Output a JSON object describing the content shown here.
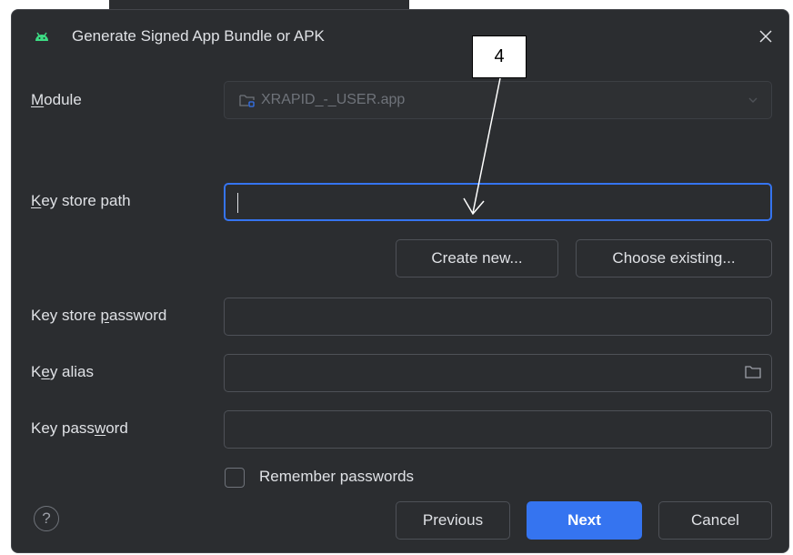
{
  "window": {
    "title": "Generate Signed App Bundle or APK"
  },
  "module": {
    "label": "Module",
    "value": "XRAPID_-_USER.app"
  },
  "key_store_path": {
    "label": "Key store path",
    "value": ""
  },
  "buttons": {
    "create_new": "Create new...",
    "choose_existing": "Choose existing...",
    "previous": "Previous",
    "next": "Next",
    "cancel": "Cancel"
  },
  "key_store_password": {
    "label": "Key store password",
    "value": ""
  },
  "key_alias": {
    "label": "Key alias",
    "value": ""
  },
  "key_password": {
    "label": "Key password",
    "value": ""
  },
  "remember": {
    "label": "Remember passwords",
    "checked": false
  },
  "help": "?",
  "annotation": {
    "label": "4"
  },
  "colors": {
    "accent": "#3574f0",
    "background": "#2b2d30"
  }
}
